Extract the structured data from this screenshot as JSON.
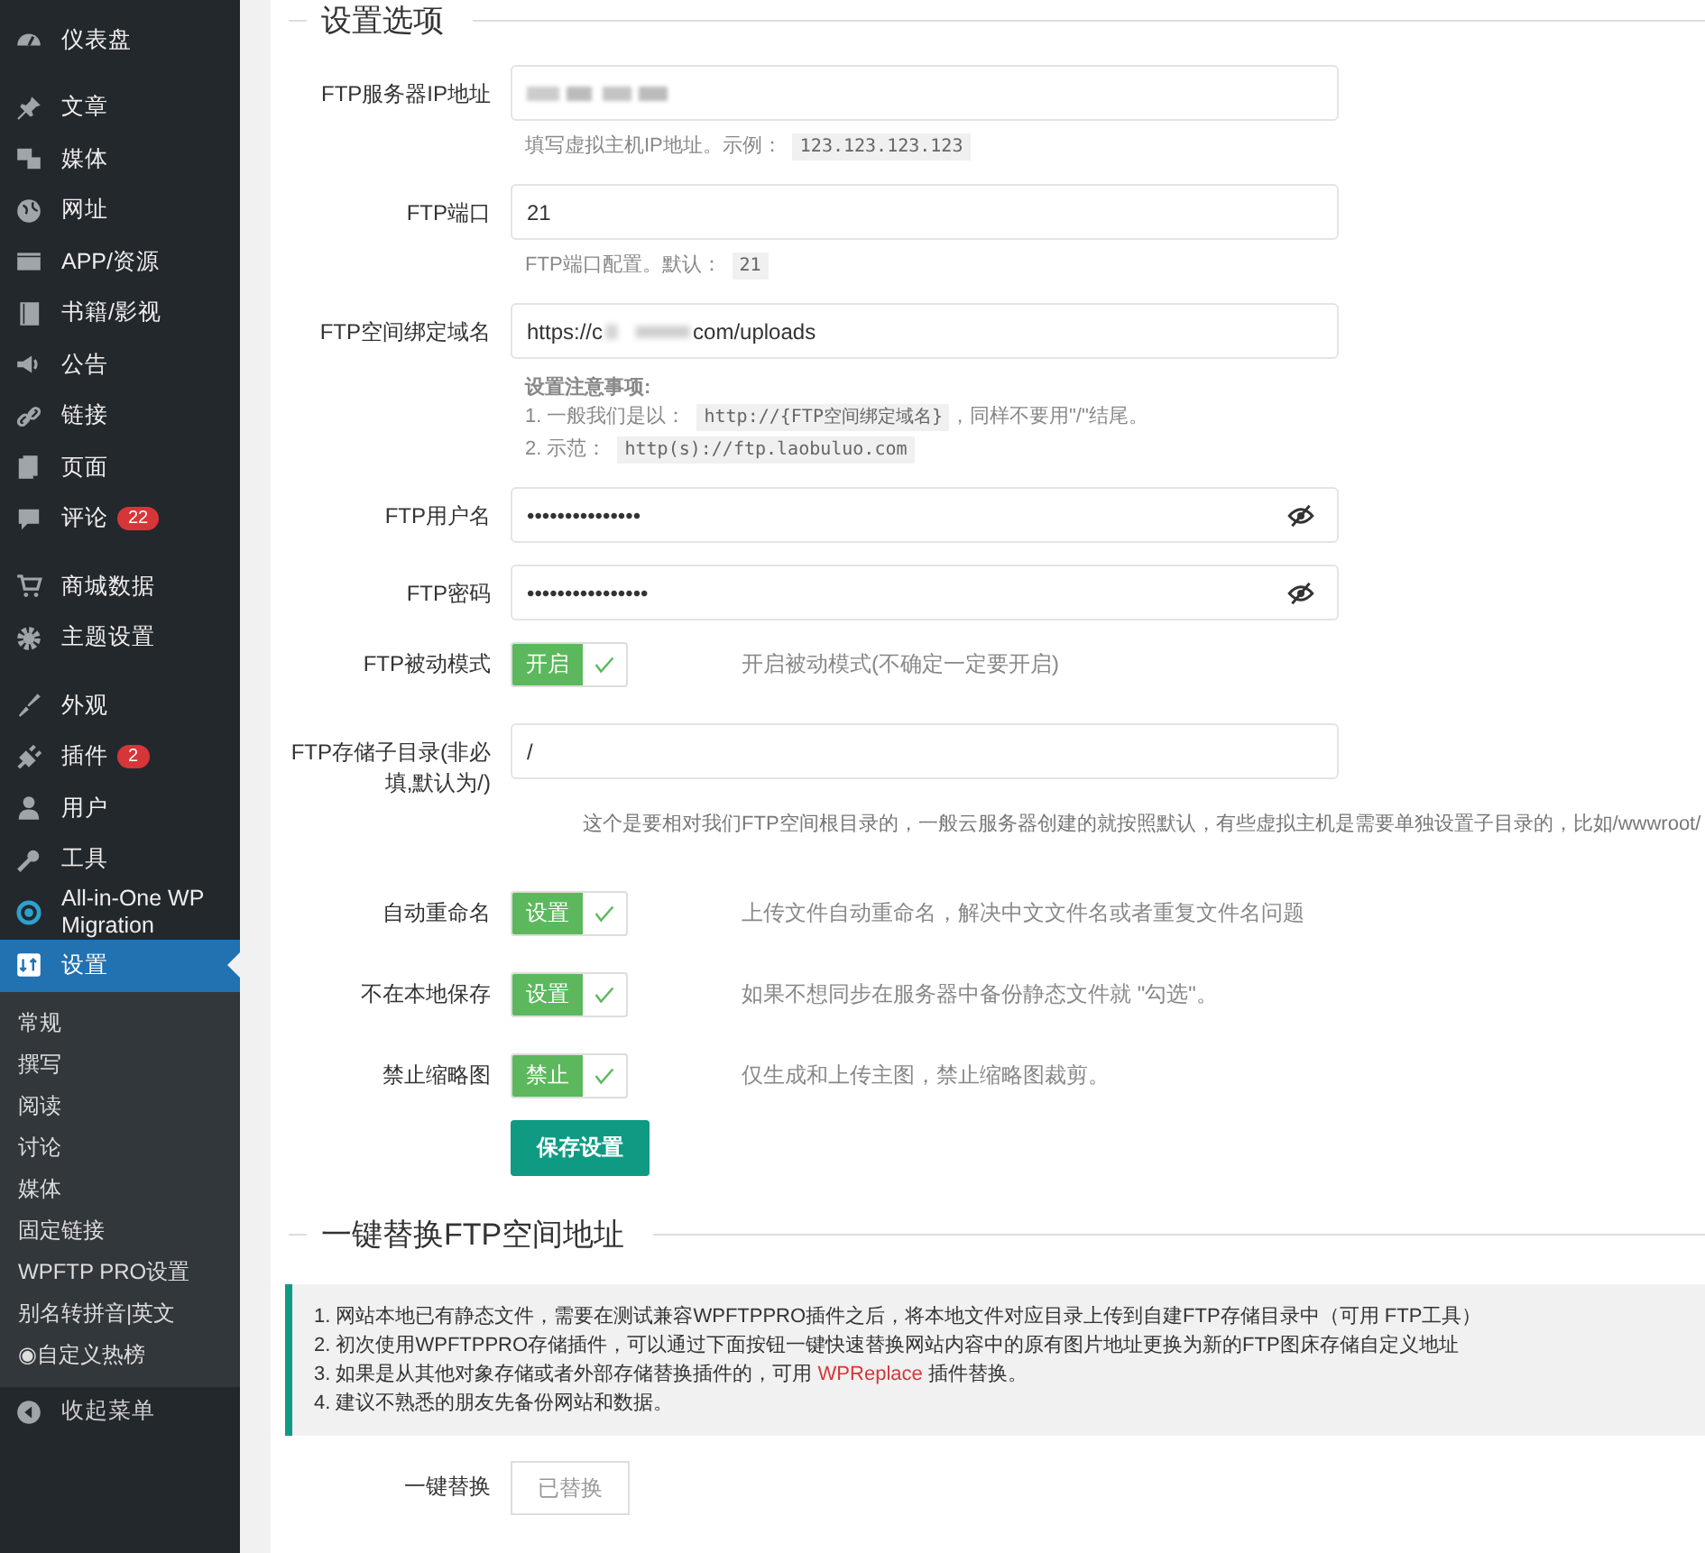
{
  "sidebar": {
    "groups": [
      [
        {
          "label": "仪表盘"
        }
      ],
      [
        {
          "label": "文章"
        },
        {
          "label": "媒体"
        },
        {
          "label": "网址"
        },
        {
          "label": "APP/资源"
        },
        {
          "label": "书籍/影视"
        },
        {
          "label": "公告"
        },
        {
          "label": "链接"
        },
        {
          "label": "页面"
        },
        {
          "label": "评论",
          "badge": "22"
        }
      ],
      [
        {
          "label": "商城数据"
        },
        {
          "label": "主题设置"
        }
      ],
      [
        {
          "label": "外观"
        },
        {
          "label": "插件",
          "badge": "2"
        },
        {
          "label": "用户"
        },
        {
          "label": "工具"
        },
        {
          "label": "All-in-One WP Migration"
        },
        {
          "label": "设置",
          "selected": true,
          "submenu": [
            {
              "label": "常规"
            },
            {
              "label": "撰写"
            },
            {
              "label": "阅读"
            },
            {
              "label": "讨论"
            },
            {
              "label": "媒体"
            },
            {
              "label": "固定链接"
            },
            {
              "label": "WPFTP PRO设置"
            },
            {
              "label": "别名转拼音|英文"
            },
            {
              "label": "◉自定义热榜"
            }
          ]
        }
      ]
    ],
    "collapse": "收起菜单"
  },
  "settings": {
    "title": "设置选项",
    "fields": [
      {
        "kind": "text",
        "label": "FTP服务器IP地址",
        "redacted": true,
        "help": "填写虚拟主机IP地址。示例：",
        "help_code": "123.123.123.123"
      },
      {
        "kind": "text",
        "label": "FTP端口",
        "value": "21",
        "help": "FTP端口配置。默认：",
        "help_code": "21"
      },
      {
        "kind": "domain",
        "label": "FTP空间绑定域名",
        "value_start": "https://c",
        "value_end": "com/uploads",
        "notes_title": "设置注意事项:",
        "notes": [
          {
            "text": "1. 一般我们是以：",
            "code": "http://{FTP空间绑定域名}",
            "after": "，同样不要用\"/\"结尾。"
          },
          {
            "text": "2. 示范：",
            "code": "http(s)://ftp.laobuluo.com"
          }
        ]
      },
      {
        "kind": "password",
        "label": "FTP用户名",
        "value": "•••••••••••••••"
      },
      {
        "kind": "password",
        "label": "FTP密码",
        "value": "••••••••••••••••"
      },
      {
        "kind": "toggle",
        "label": "FTP被动模式",
        "toggle": "开启",
        "on": true,
        "desc": "开启被动模式(不确定一定要开启)"
      },
      {
        "kind": "text",
        "label": "FTP存储子目录(非必填,默认为/)",
        "value": "/",
        "desc_wide": "这个是要相对我们FTP空间根目录的，一般云服务器创建的就按照默认，有些虚拟主机是需要单独设置子目录的，比如/wwwroot/"
      },
      {
        "kind": "toggle",
        "label": "自动重命名",
        "toggle": "设置",
        "on": true,
        "desc": "上传文件自动重命名，解决中文文件名或者重复文件名问题"
      },
      {
        "kind": "toggle",
        "label": "不在本地保存",
        "toggle": "设置",
        "on": true,
        "desc": "如果不想同步在服务器中备份静态文件就 \"勾选\"。"
      },
      {
        "kind": "toggle",
        "label": "禁止缩略图",
        "toggle": "禁止",
        "on": true,
        "desc": "仅生成和上传主图，禁止缩略图裁剪。"
      }
    ],
    "save": "保存设置"
  },
  "replace": {
    "title": "一键替换FTP空间地址",
    "notice": [
      {
        "text": "1. 网站本地已有静态文件，需要在测试兼容WPFTPPRO插件之后，将本地文件对应目录上传到自建FTP存储目录中（可用 FTP工具）"
      },
      {
        "text": "2. 初次使用WPFTPPRO存储插件，可以通过下面按钮一键快速替换网站内容中的原有图片地址更换为新的FTP图床存储自定义地址"
      },
      {
        "text": "3. 如果是从其他对象存储或者外部存储替换插件的，可用 ",
        "link": "WPReplace",
        "after": " 插件替换。"
      },
      {
        "text": "4. 建议不熟悉的朋友先备份网站和数据。"
      }
    ],
    "label": "一键替换",
    "button": "已替换",
    "disabled": true
  }
}
